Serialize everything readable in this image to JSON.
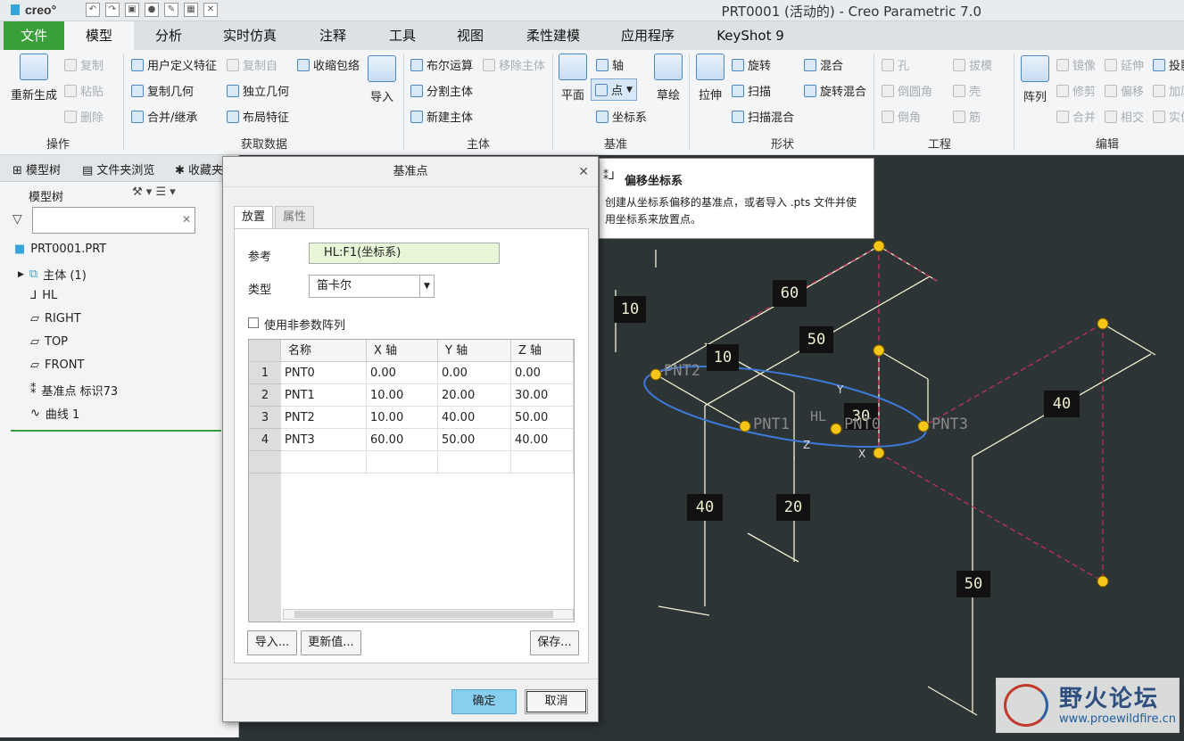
{
  "window": {
    "title": "PRT0001 (活动的) - Creo Parametric 7.0",
    "logo": "creo°"
  },
  "menu": {
    "tabs": [
      "文件",
      "模型",
      "分析",
      "实时仿真",
      "注释",
      "工具",
      "视图",
      "柔性建模",
      "应用程序",
      "KeyShot 9"
    ]
  },
  "ribbon": {
    "ops": {
      "regen": "重新生成",
      "copy": "复制",
      "paste": "粘贴",
      "delete": "删除",
      "label": "操作"
    },
    "get": {
      "udf": "用户定义特征",
      "copyfrom": "复制自",
      "shrink": "收缩包络",
      "copygeom": "复制几何",
      "indepgeom": "独立几何",
      "merge": "合并/继承",
      "layout": "布局特征",
      "import": "导入",
      "label": "获取数据"
    },
    "body": {
      "bool": "布尔运算",
      "remove": "移除主体",
      "split": "分割主体",
      "newbody": "新建主体",
      "label": "主体"
    },
    "datum": {
      "plane": "平面",
      "axis": "轴",
      "point": "点",
      "csys": "坐标系",
      "sketch": "草绘",
      "label": "基准"
    },
    "shape": {
      "extrude": "拉伸",
      "revolve": "旋转",
      "sweep": "扫描",
      "sweepblend": "扫描混合",
      "blend": "混合",
      "revblend": "旋转混合",
      "label": "形状"
    },
    "eng": {
      "hole": "孔",
      "round": "倒圆角",
      "chamfer": "倒角",
      "draft": "拔模",
      "shell": "壳",
      "rib": "筋",
      "label": "工程"
    },
    "edit": {
      "pattern": "阵列",
      "mirror": "镜像",
      "trim": "修剪",
      "merge": "合并",
      "extend": "延伸",
      "offset": "偏移",
      "intersect": "相交",
      "project": "投影",
      "thicken": "加厚",
      "solidify": "实体化",
      "label": "编辑"
    }
  },
  "sidebar": {
    "tabs": [
      "模型树",
      "文件夹浏览",
      "收藏夹"
    ],
    "tree_title": "模型树",
    "items": [
      "PRT0001.PRT",
      "主体 (1)",
      "HL",
      "RIGHT",
      "TOP",
      "FRONT",
      "基准点 标识73",
      "曲线 1"
    ]
  },
  "dialog": {
    "title": "基准点",
    "tabs": [
      "放置",
      "属性"
    ],
    "ref_label": "参考",
    "ref_value": "HL:F1(坐标系)",
    "type_label": "类型",
    "type_value": "笛卡尔",
    "nonparam_label": "使用非参数阵列",
    "columns": [
      "名称",
      "X 轴",
      "Y 轴",
      "Z 轴"
    ],
    "rows": [
      {
        "n": "1",
        "name": "PNT0",
        "x": "0.00",
        "y": "0.00",
        "z": "0.00"
      },
      {
        "n": "2",
        "name": "PNT1",
        "x": "10.00",
        "y": "20.00",
        "z": "30.00"
      },
      {
        "n": "3",
        "name": "PNT2",
        "x": "10.00",
        "y": "40.00",
        "z": "50.00"
      },
      {
        "n": "4",
        "name": "PNT3",
        "x": "60.00",
        "y": "50.00",
        "z": "40.00"
      }
    ],
    "import_btn": "导入...",
    "update_btn": "更新值...",
    "save_btn": "保存...",
    "ok_btn": "确定",
    "cancel_btn": "取消"
  },
  "tooltip": {
    "title": "偏移坐标系",
    "body": "创建从坐标系偏移的基准点，或者导入 .pts 文件并使用坐标系来放置点。"
  },
  "viewport": {
    "dims": [
      "10",
      "60",
      "50",
      "10",
      "30",
      "40",
      "40",
      "20",
      "50"
    ],
    "points": [
      "PNT2",
      "PNT1",
      "PNT0",
      "PNT3"
    ],
    "labels": [
      "HL",
      "Y",
      "X",
      "Z"
    ]
  },
  "watermark": {
    "name": "野火论坛",
    "url": "www.proewildfire.cn"
  },
  "colors": {
    "accent": "#3a9e3a",
    "point": "#f5c518",
    "curve": "#3c7bd9",
    "dashed": "#c0305a",
    "dim": "#f1efd0"
  }
}
